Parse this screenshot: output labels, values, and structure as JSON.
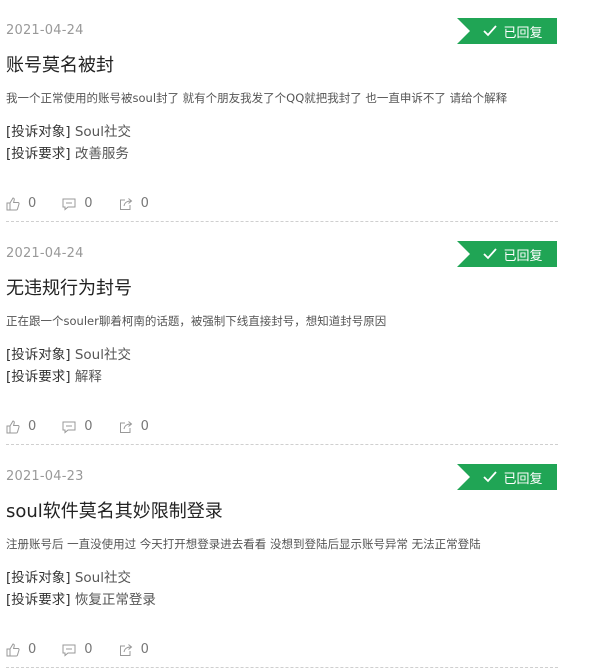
{
  "items": [
    {
      "date": "2021-04-24",
      "status": "已回复",
      "title": "账号莫名被封",
      "description": "我一个正常使用的账号被soul封了 就有个朋友我发了个QQ就把我封了 也一直申诉不了 请给个解释",
      "target_label": "[投诉对象]",
      "target_value": "Soul社交",
      "request_label": "[投诉要求]",
      "request_value": "改善服务",
      "likes": "0",
      "comments": "0",
      "shares": "0"
    },
    {
      "date": "2021-04-24",
      "status": "已回复",
      "title": "无违规行为封号",
      "description": "正在跟一个souler聊着柯南的话题，被强制下线直接封号，想知道封号原因",
      "target_label": "[投诉对象]",
      "target_value": "Soul社交",
      "request_label": "[投诉要求]",
      "request_value": "解释",
      "likes": "0",
      "comments": "0",
      "shares": "0"
    },
    {
      "date": "2021-04-23",
      "status": "已回复",
      "title": "soul软件莫名其妙限制登录",
      "description": "注册账号后 一直没使用过 今天打开想登录进去看看 没想到登陆后显示账号异常 无法正常登陆",
      "target_label": "[投诉对象]",
      "target_value": "Soul社交",
      "request_label": "[投诉要求]",
      "request_value": "恢复正常登录",
      "likes": "0",
      "comments": "0",
      "shares": "0"
    }
  ],
  "colors": {
    "accent": "#20a555",
    "divider": "#cfcfcf"
  },
  "icons": {
    "status": "check-icon",
    "like": "thumbs-up-icon",
    "comment": "comment-icon",
    "share": "share-icon"
  }
}
